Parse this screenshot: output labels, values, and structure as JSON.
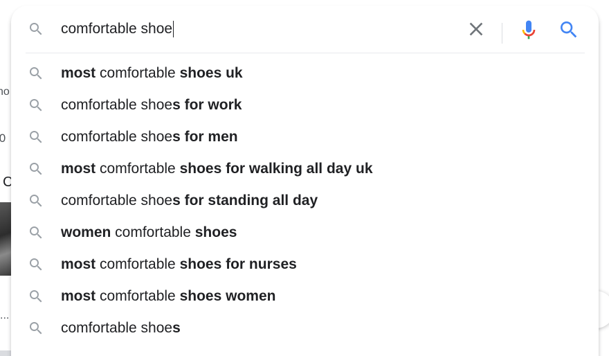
{
  "background": {
    "fragment_1": "no",
    "fragment_2": ",0",
    "fragment_3": "C",
    "fragment_4": "..."
  },
  "search": {
    "query": "comfortable shoe",
    "placeholder": "",
    "icons": {
      "left": "search-icon",
      "clear": "close-icon",
      "voice": "microphone-icon",
      "submit": "search-icon"
    }
  },
  "suggestions": [
    {
      "parts": [
        {
          "text": "most",
          "bold": true
        },
        {
          "text": " comfortable ",
          "bold": false
        },
        {
          "text": "shoes uk",
          "bold": true
        }
      ]
    },
    {
      "parts": [
        {
          "text": "comfortable shoe",
          "bold": false
        },
        {
          "text": "s for work",
          "bold": true
        }
      ]
    },
    {
      "parts": [
        {
          "text": "comfortable shoe",
          "bold": false
        },
        {
          "text": "s for men",
          "bold": true
        }
      ]
    },
    {
      "parts": [
        {
          "text": "most",
          "bold": true
        },
        {
          "text": " comfortable ",
          "bold": false
        },
        {
          "text": "shoes for walking all day uk",
          "bold": true
        }
      ]
    },
    {
      "parts": [
        {
          "text": "comfortable shoe",
          "bold": false
        },
        {
          "text": "s for standing all day",
          "bold": true
        }
      ]
    },
    {
      "parts": [
        {
          "text": "women",
          "bold": true
        },
        {
          "text": " comfortable ",
          "bold": false
        },
        {
          "text": "shoes",
          "bold": true
        }
      ]
    },
    {
      "parts": [
        {
          "text": "most",
          "bold": true
        },
        {
          "text": " comfortable ",
          "bold": false
        },
        {
          "text": "shoes for nurses",
          "bold": true
        }
      ]
    },
    {
      "parts": [
        {
          "text": "most",
          "bold": true
        },
        {
          "text": " comfortable ",
          "bold": false
        },
        {
          "text": "shoes women",
          "bold": true
        }
      ]
    },
    {
      "parts": [
        {
          "text": "comfortable shoe",
          "bold": false
        },
        {
          "text": "s",
          "bold": true
        }
      ]
    }
  ],
  "colors": {
    "icon_grey": "#9aa0a6",
    "clear_grey": "#70757a",
    "google_blue": "#4285f4",
    "google_red": "#ea4335",
    "google_yellow": "#fbbc05",
    "google_green": "#34a853"
  }
}
